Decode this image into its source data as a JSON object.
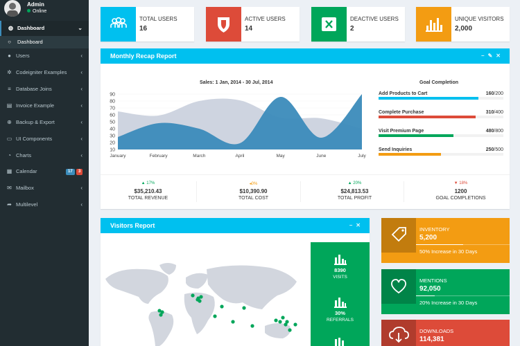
{
  "user": {
    "name": "Admin",
    "status": "Online"
  },
  "sidebar": {
    "items": [
      {
        "label": "Dashboard",
        "icon": "dashboard-icon"
      },
      {
        "label": "Dashboard",
        "icon": "circle-outline-icon"
      },
      {
        "label": "Users",
        "icon": "user-icon"
      },
      {
        "label": "Codeigniter Examples",
        "icon": "gear-icon"
      },
      {
        "label": "Database Joins",
        "icon": "database-icon"
      },
      {
        "label": "Invoice Example",
        "icon": "file-icon"
      },
      {
        "label": "Backup & Export",
        "icon": "backup-icon"
      },
      {
        "label": "UI Components",
        "icon": "laptop-icon"
      },
      {
        "label": "Charts",
        "icon": "pie-chart-icon"
      },
      {
        "label": "Calendar",
        "icon": "calendar-icon",
        "badges": [
          "17",
          "3"
        ]
      },
      {
        "label": "Mailbox",
        "icon": "envelope-icon"
      },
      {
        "label": "Multilevel",
        "icon": "share-icon"
      }
    ]
  },
  "info_boxes": [
    {
      "label": "TOTAL USERS",
      "value": "16",
      "color": "#00c0ef",
      "icon": "users-icon"
    },
    {
      "label": "ACTIVE USERS",
      "value": "14",
      "color": "#dd4b39",
      "icon": "shield-icon"
    },
    {
      "label": "DEACTIVE USERS",
      "value": "2",
      "color": "#00a65a",
      "icon": "close-icon"
    },
    {
      "label": "UNIQUE VISITORS",
      "value": "2,000",
      "color": "#f39c12",
      "icon": "bar-chart-icon"
    }
  ],
  "recap": {
    "title": "Monthly Recap Report",
    "sales_title": "Sales: 1 Jan, 2014 - 30 Jul, 2014",
    "goal_title": "Goal Completion",
    "goals": [
      {
        "label": "Add Products to Cart",
        "value": "160",
        "total": "/200",
        "color": "#00c0ef",
        "fraction": 0.8
      },
      {
        "label": "Complete Purchase",
        "value": "310",
        "total": "/400",
        "color": "#dd4b39",
        "fraction": 0.775
      },
      {
        "label": "Visit Premium Page",
        "value": "480",
        "total": "/800",
        "color": "#00a65a",
        "fraction": 0.6
      },
      {
        "label": "Send Inquiries",
        "value": "250",
        "total": "/500",
        "color": "#f39c12",
        "fraction": 0.5
      }
    ],
    "stats": [
      {
        "pct": "17%",
        "dir": "up",
        "color": "#00a65a",
        "amount": "$35,210.43",
        "label": "TOTAL REVENUE"
      },
      {
        "pct": "0%",
        "dir": "flat",
        "color": "#f39c12",
        "amount": "$10,390.90",
        "label": "TOTAL COST"
      },
      {
        "pct": "20%",
        "dir": "up",
        "color": "#00a65a",
        "amount": "$24,813.53",
        "label": "TOTAL PROFIT"
      },
      {
        "pct": "18%",
        "dir": "down",
        "color": "#dd4b39",
        "amount": "1200",
        "label": "GOAL COMPLETIONS"
      }
    ]
  },
  "chart_data": {
    "type": "area",
    "title": "Sales: 1 Jan, 2014 - 30 Jul, 2014",
    "categories": [
      "January",
      "February",
      "March",
      "April",
      "May",
      "June",
      "July"
    ],
    "ylim": [
      10,
      90
    ],
    "yticks": [
      10,
      20,
      30,
      40,
      50,
      60,
      70,
      80,
      90
    ],
    "series": [
      {
        "color": "#c9cfdd",
        "values": [
          65,
          59,
          80,
          81,
          56,
          55,
          40
        ]
      },
      {
        "color": "#3b8bba",
        "values": [
          28,
          48,
          40,
          19,
          86,
          27,
          90
        ]
      }
    ]
  },
  "visitors": {
    "title": "Visitors Report",
    "stats": [
      {
        "value": "8390",
        "label": "VISITS"
      },
      {
        "value": "30%",
        "label": "REFERRALS"
      }
    ]
  },
  "tiles": [
    {
      "title": "INVENTORY",
      "number": "5,200",
      "desc": "50% Increase in 30 Days",
      "color": "#f39c12",
      "icon": "tag-icon",
      "progress": 0.5
    },
    {
      "title": "MENTIONS",
      "number": "92,050",
      "desc": "20% Increase in 30 Days",
      "color": "#00a65a",
      "icon": "heart-icon",
      "progress": 0.2
    },
    {
      "title": "DOWNLOADS",
      "number": "114,381",
      "desc": "",
      "color": "#dd4b39",
      "icon": "cloud-download-icon",
      "progress": 0.7
    }
  ]
}
